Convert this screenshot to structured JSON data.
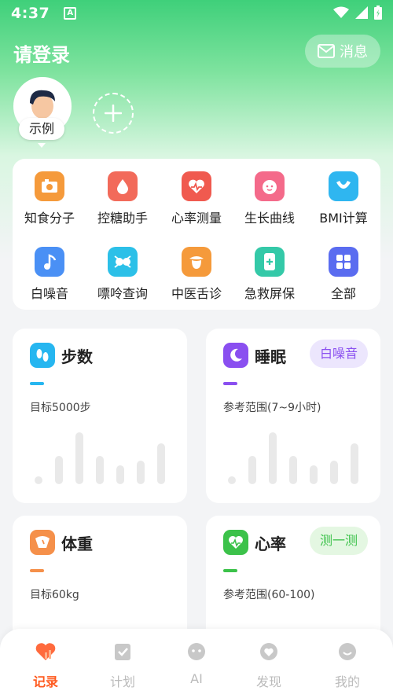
{
  "status_bar": {
    "time": "4:37",
    "a_badge": "A"
  },
  "header": {
    "title": "请登录",
    "message_label": "消息"
  },
  "profile": {
    "example_label": "示例"
  },
  "tools": [
    {
      "label": "知食分子",
      "icon": "food-icon",
      "color": "#f59a3b"
    },
    {
      "label": "控糖助手",
      "icon": "sugar-drop-icon",
      "color": "#f26a5a"
    },
    {
      "label": "心率测量",
      "icon": "heart-rate-icon",
      "color": "#f05a4f"
    },
    {
      "label": "生长曲线",
      "icon": "baby-face-icon",
      "color": "#f46a8a"
    },
    {
      "label": "BMI计算",
      "icon": "bmi-icon",
      "color": "#2fb6f0"
    },
    {
      "label": "白噪音",
      "icon": "music-note-icon",
      "color": "#4a90f5"
    },
    {
      "label": "嘌呤查询",
      "icon": "purine-icon",
      "color": "#2cc0e8"
    },
    {
      "label": "中医舌诊",
      "icon": "tongue-icon",
      "color": "#f59a3b"
    },
    {
      "label": "急救屏保",
      "icon": "first-aid-phone-icon",
      "color": "#34c9a8"
    },
    {
      "label": "全部",
      "icon": "grid-icon",
      "color": "#5a6cf0"
    }
  ],
  "cards": {
    "steps": {
      "title": "步数",
      "subtitle": "目标5000步",
      "color": "#26b6f0"
    },
    "sleep": {
      "title": "睡眠",
      "subtitle": "参考范围(7~9小时)",
      "action": "白噪音",
      "color": "#8a4ff0"
    },
    "weight": {
      "title": "体重",
      "subtitle": "目标60kg",
      "color": "#f5904a"
    },
    "heart": {
      "title": "心率",
      "subtitle": "参考范围(60-100)",
      "action": "测一测",
      "color": "#3cc24a"
    }
  },
  "tabs": [
    {
      "label": "记录",
      "icon": "record-icon",
      "active": true
    },
    {
      "label": "计划",
      "icon": "plan-icon",
      "active": false
    },
    {
      "label": "AI",
      "icon": "ai-chat-icon",
      "active": false
    },
    {
      "label": "发现",
      "icon": "discover-icon",
      "active": false
    },
    {
      "label": "我的",
      "icon": "profile-icon",
      "active": false
    }
  ],
  "colors": {
    "accent_green": "#3fd07a",
    "tab_active": "#ff5a1f"
  }
}
